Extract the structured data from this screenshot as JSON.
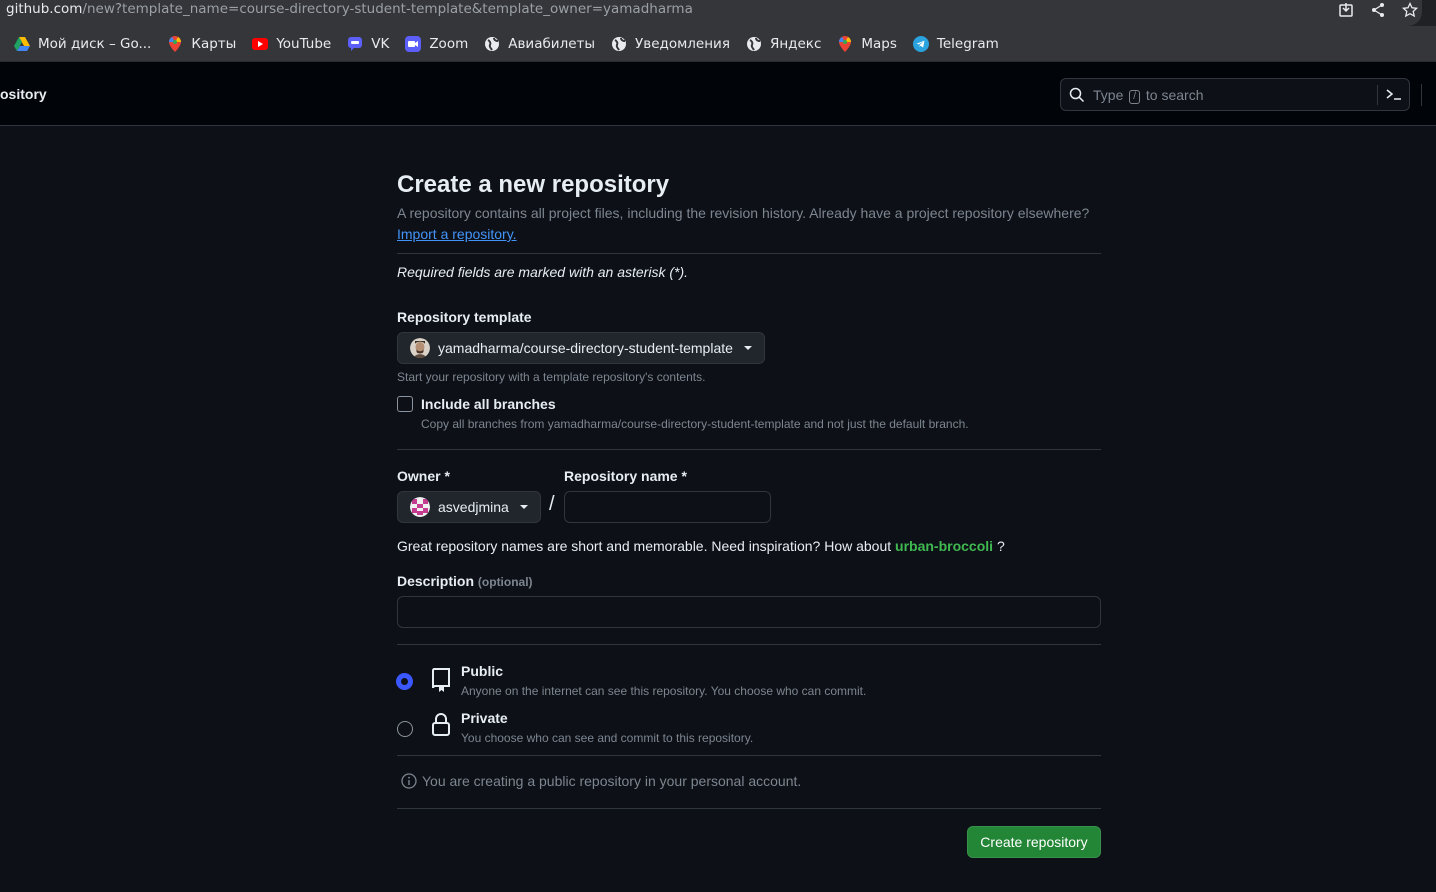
{
  "browser": {
    "url_host": "github.com",
    "url_path": "/new?template_name=course-directory-student-template&template_owner=yamadharma",
    "bookmarks": [
      {
        "label": "Мой диск – Go...",
        "icon": "google-drive-icon"
      },
      {
        "label": "Карты",
        "icon": "google-maps-icon"
      },
      {
        "label": "YouTube",
        "icon": "youtube-icon"
      },
      {
        "label": "VK",
        "icon": "vk-icon"
      },
      {
        "label": "Zoom",
        "icon": "zoom-icon"
      },
      {
        "label": "Авиабилеты",
        "icon": "globe-icon"
      },
      {
        "label": "Уведомления",
        "icon": "globe-icon"
      },
      {
        "label": "Яндекс",
        "icon": "globe-icon"
      },
      {
        "label": "Maps",
        "icon": "google-maps-icon"
      },
      {
        "label": "Telegram",
        "icon": "telegram-icon"
      }
    ]
  },
  "header": {
    "page_title": "ository",
    "search_prefix": "Type",
    "search_key": "/",
    "search_suffix": "to search"
  },
  "form": {
    "title": "Create a new repository",
    "subtitle": "A repository contains all project files, including the revision history. Already have a project repository elsewhere?",
    "import_link": "Import a repository.",
    "required_note": "Required fields are marked with an asterisk (*).",
    "template_label": "Repository template",
    "template_value": "yamadharma/course-directory-student-template",
    "template_note": "Start your repository with a template repository's contents.",
    "include_branches_label": "Include all branches",
    "include_branches_note": "Copy all branches from yamadharma/course-directory-student-template and not just the default branch.",
    "owner_label": "Owner *",
    "owner_value": "asvedjmina",
    "slash": "/",
    "repo_name_label": "Repository name *",
    "repo_name_value": "",
    "inspiration_text": "Great repository names are short and memorable. Need inspiration? How about",
    "inspiration_suggestion": "urban-broccoli",
    "inspiration_end": "?",
    "description_label": "Description",
    "description_optional": "(optional)",
    "description_value": "",
    "public_title": "Public",
    "public_desc": "Anyone on the internet can see this repository. You choose who can commit.",
    "private_title": "Private",
    "private_desc": "You choose who can see and commit to this repository.",
    "visibility_selected": "Public",
    "info_text": "You are creating a public repository in your personal account.",
    "create_button": "Create repository"
  },
  "colors": {
    "background": "#0d1117",
    "primary_button": "#238636",
    "link": "#4493f8",
    "suggestion": "#3fb950",
    "radio_selected": "#3b57ff"
  }
}
